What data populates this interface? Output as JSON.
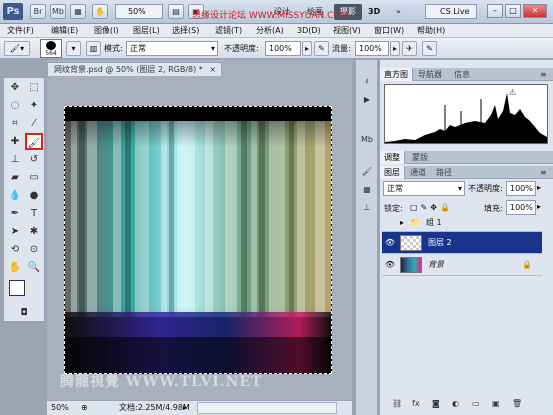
{
  "app": {
    "logo": "Ps",
    "zoom": "50%",
    "workspaces": [
      "设计",
      "绘画",
      "摄影"
    ],
    "active_workspace": "摄影",
    "workspace_3d": "3D",
    "overlay_url": "思缘设计论坛 WWW.MISSYUAN.COM",
    "cs_live": "CS Live"
  },
  "menu": [
    "文件(F)",
    "编辑(E)",
    "图像(I)",
    "图层(L)",
    "选择(S)",
    "滤镜(T)",
    "分析(A)",
    "3D(D)",
    "视图(V)",
    "窗口(W)",
    "帮助(H)"
  ],
  "options": {
    "brush_size": "564",
    "mode_label": "模式:",
    "mode_value": "正常",
    "opacity_label": "不透明度:",
    "opacity_value": "100%",
    "flow_label": "流量:",
    "flow_value": "100%"
  },
  "document": {
    "tab_title": "网纹背景.psd @ 50% (图层 2, RGB/8) *",
    "tab_close": "×",
    "watermark": "腾龍視覺 WWW.TLVI.NET",
    "status_zoom": "50%",
    "status_doc": "文档:2.25M/4.98M"
  },
  "histogram_panel": {
    "tabs": [
      "直方图",
      "导航器",
      "信息"
    ]
  },
  "adjust_panel": {
    "tabs": [
      "调整",
      "蒙版"
    ]
  },
  "layers_panel": {
    "tabs": [
      "图层",
      "通道",
      "路径"
    ],
    "blend_mode": "正常",
    "opacity_label": "不透明度:",
    "opacity_value": "100%",
    "lock_label": "锁定:",
    "fill_label": "填充:",
    "fill_value": "100%",
    "layers": [
      {
        "name": "组 1",
        "type": "group"
      },
      {
        "name": "图层 2",
        "type": "layer",
        "selected": true
      },
      {
        "name": "背景",
        "type": "background",
        "locked": true
      }
    ]
  },
  "colors": {
    "titlebar": "#c4d0e0",
    "selection": "#19348c",
    "active_tool_border": "#dd2211"
  }
}
